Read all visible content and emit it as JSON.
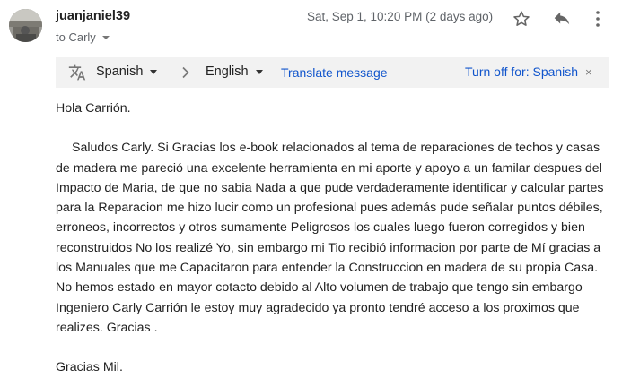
{
  "header": {
    "sender": "juanjaniel39",
    "recipient": "to Carly",
    "timestamp": "Sat, Sep 1, 10:20 PM (2 days ago)"
  },
  "icons": {
    "avatar": "avatar-photo",
    "star": "star-icon",
    "reply": "reply-icon",
    "more": "more-vert-icon",
    "translate": "translate-icon",
    "chevron": "chevron-right-icon",
    "close": "close-icon"
  },
  "translate_bar": {
    "source_language": "Spanish",
    "target_language": "English",
    "translate_link": "Translate message",
    "turn_off": "Turn off for: Spanish",
    "close": "×"
  },
  "message": {
    "greeting": "Hola Carrión.",
    "paragraph": "Saludos Carly. Si Gracias los e-book relacionados al tema de reparaciones de techos y casas de madera me pareció una excelente herramienta en mi aporte y apoyo a un familar despues del Impacto de Maria, de que no sabia Nada a que pude verdaderamente identificar y calcular partes para la Reparacion me hizo lucir como un profesional pues además pude señalar puntos débiles, erroneos, incorrectos y otros sumamente Peligrosos los cuales luego fueron corregidos y bien reconstruidos No los realizé Yo, sin embargo mi Tio recibió informacion por parte de Mí gracias a los Manuales que me Capacitaron para entender la Construccion en madera de su propia Casa. No hemos estado en mayor cotacto debido al Alto volumen de trabajo que tengo sin embargo Ingeniero Carly Carrión le estoy muy agradecido ya pronto tendré acceso a los proximos que realizes. Gracias .",
    "closing": "Gracias Mil."
  }
}
